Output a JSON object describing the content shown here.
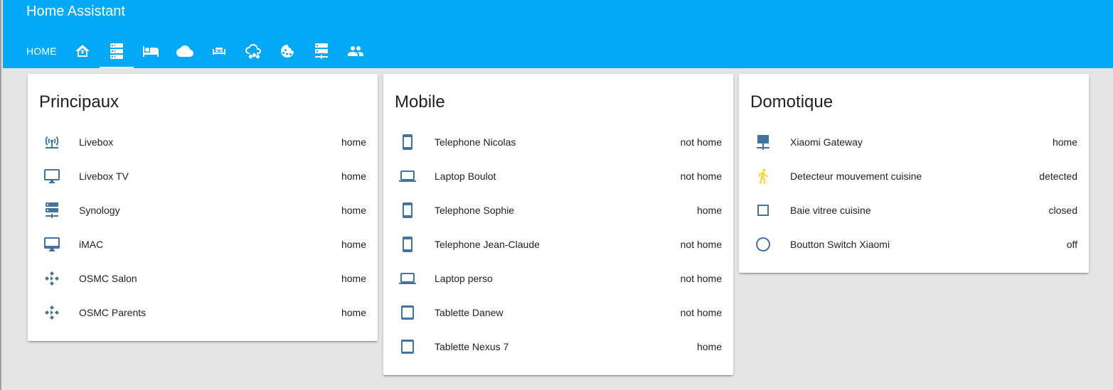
{
  "header": {
    "title": "Home Assistant",
    "tabs": [
      {
        "label": "HOME",
        "active": false
      },
      {
        "icon": "home-automation-icon",
        "active": false
      },
      {
        "icon": "server-icon",
        "active": true
      },
      {
        "icon": "bed-icon",
        "active": false
      },
      {
        "icon": "cloud-icon",
        "active": false
      },
      {
        "icon": "sofa-icon",
        "active": false
      },
      {
        "icon": "weather-rainy-icon",
        "active": false
      },
      {
        "icon": "cookie-icon",
        "active": false
      },
      {
        "icon": "server-network-icon",
        "active": false
      },
      {
        "icon": "account-multiple-icon",
        "active": false
      }
    ]
  },
  "colors": {
    "header": "#03a9f4",
    "icon": "#44739e",
    "motion": "#fdd835",
    "background": "#e5e5e5"
  },
  "cards": [
    {
      "title": "Principaux",
      "rows": [
        {
          "icon": "access-point-network-icon",
          "name": "Livebox",
          "state": "home"
        },
        {
          "icon": "monitor-icon",
          "name": "Livebox TV",
          "state": "home"
        },
        {
          "icon": "server-icon",
          "name": "Synology",
          "state": "home"
        },
        {
          "icon": "desktop-mac-icon",
          "name": "iMAC",
          "state": "home"
        },
        {
          "icon": "kodi-icon",
          "name": "OSMC Salon",
          "state": "home"
        },
        {
          "icon": "kodi-icon",
          "name": "OSMC Parents",
          "state": "home"
        }
      ]
    },
    {
      "title": "Mobile",
      "rows": [
        {
          "icon": "cellphone-icon",
          "name": "Telephone Nicolas",
          "state": "not home"
        },
        {
          "icon": "laptop-icon",
          "name": "Laptop Boulot",
          "state": "not home"
        },
        {
          "icon": "cellphone-icon",
          "name": "Telephone Sophie",
          "state": "home"
        },
        {
          "icon": "cellphone-icon",
          "name": "Telephone Jean-Claude",
          "state": "not home"
        },
        {
          "icon": "laptop-icon",
          "name": "Laptop perso",
          "state": "not home"
        },
        {
          "icon": "tablet-icon",
          "name": "Tablette Danew",
          "state": "not home"
        },
        {
          "icon": "tablet-icon",
          "name": "Tablette Nexus 7",
          "state": "home"
        }
      ]
    },
    {
      "title": "Domotique",
      "rows": [
        {
          "icon": "gateway-icon",
          "name": "Xiaomi Gateway",
          "state": "home"
        },
        {
          "icon": "motion-run-icon",
          "name": "Detecteur mouvement cuisine",
          "state": "detected"
        },
        {
          "icon": "square-outline-icon",
          "name": "Baie vitree cuisine",
          "state": "closed"
        },
        {
          "icon": "circle-outline-icon",
          "name": "Boutton Switch Xiaomi",
          "state": "off"
        }
      ]
    }
  ]
}
